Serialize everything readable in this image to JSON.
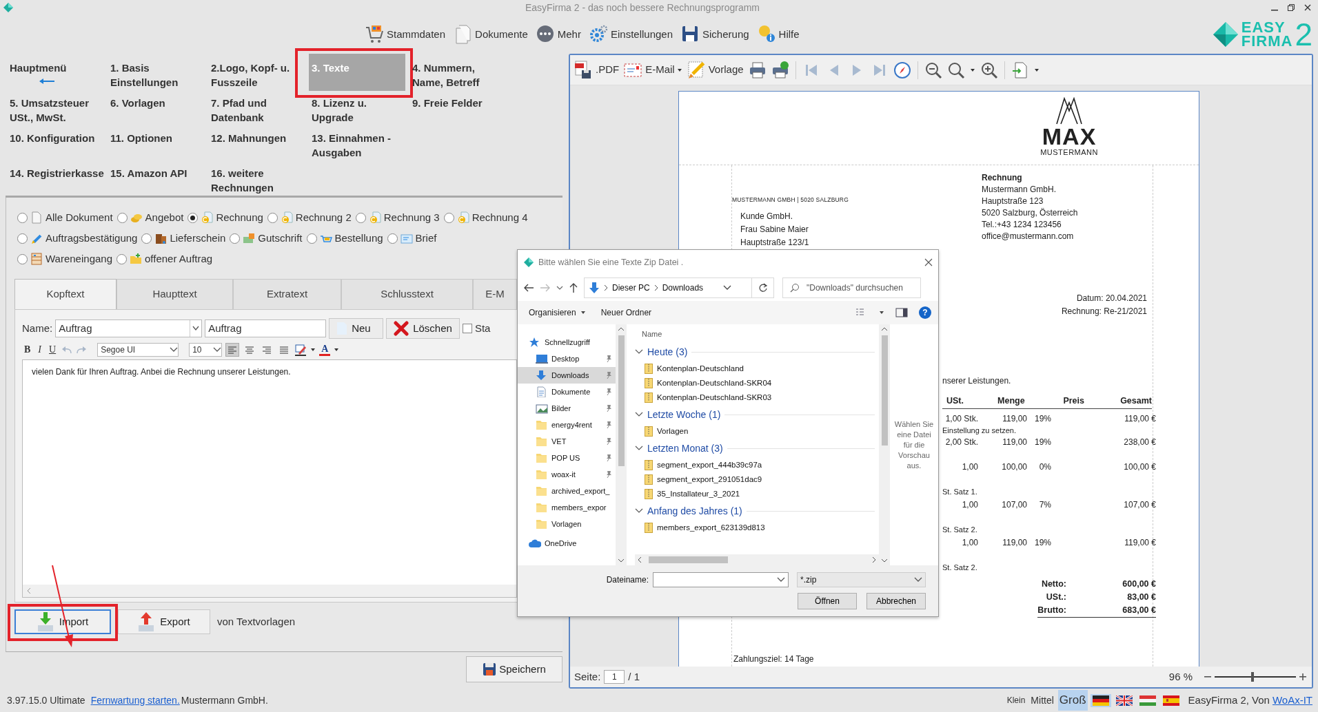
{
  "window": {
    "title": "EasyFirma 2 - das noch bessere Rechnungsprogramm"
  },
  "toolbar": [
    {
      "label": "Stammdaten"
    },
    {
      "label": "Dokumente"
    },
    {
      "label": "Mehr"
    },
    {
      "label": "Einstellungen"
    },
    {
      "label": "Sicherung"
    },
    {
      "label": "Hilfe"
    }
  ],
  "logo": {
    "line1": "EASY",
    "line2": "FIRMA",
    "number": "2"
  },
  "main_menu": [
    [
      {
        "label": "Hauptmenü",
        "kind": "back",
        "selected": false,
        "highlighted": false
      },
      {
        "label": "1. Basis Einstellungen",
        "kind": "page",
        "selected": false,
        "highlighted": false
      },
      {
        "label": "2.Logo, Kopf- u. Fusszeile",
        "kind": "page",
        "selected": false,
        "highlighted": false
      },
      {
        "label": "3. Texte",
        "kind": "page",
        "selected": true,
        "highlighted": true
      },
      {
        "label": "4. Nummern, Name, Betreff",
        "kind": "page",
        "selected": false,
        "highlighted": false
      }
    ],
    [
      {
        "label": "5. Umsatzsteuer USt., MwSt.",
        "kind": "page",
        "selected": false,
        "highlighted": false
      },
      {
        "label": "6. Vorlagen",
        "kind": "page",
        "selected": false,
        "highlighted": false
      },
      {
        "label": "7. Pfad und Datenbank",
        "kind": "page",
        "selected": false,
        "highlighted": false
      },
      {
        "label": "8. Lizenz u. Upgrade",
        "kind": "page",
        "selected": false,
        "highlighted": false
      },
      {
        "label": "9. Freie Felder",
        "kind": "page",
        "selected": false,
        "highlighted": false
      }
    ],
    [
      {
        "label": "10. Konfiguration",
        "kind": "page",
        "selected": false,
        "highlighted": false
      },
      {
        "label": "11. Optionen",
        "kind": "page",
        "selected": false,
        "highlighted": false
      },
      {
        "label": "12. Mahnungen",
        "kind": "page",
        "selected": false,
        "highlighted": false
      },
      {
        "label": "13. Einnahmen - Ausgaben",
        "kind": "page",
        "selected": false,
        "highlighted": false
      }
    ],
    [
      {
        "label": "14. Registrierkasse",
        "kind": "page",
        "selected": false,
        "highlighted": false
      },
      {
        "label": "15. Amazon API",
        "kind": "page",
        "selected": false,
        "highlighted": false
      },
      {
        "label": "16. weitere Rechnungen",
        "kind": "page",
        "selected": false,
        "highlighted": false
      }
    ]
  ],
  "document_types": [
    [
      {
        "label": "Alle Dokument",
        "selected": false
      },
      {
        "label": "Angebot",
        "selected": false
      },
      {
        "label": "Rechnung",
        "selected": true
      },
      {
        "label": "Rechnung 2",
        "selected": false
      },
      {
        "label": "Rechnung 3",
        "selected": false
      },
      {
        "label": "Rechnung 4",
        "selected": false
      }
    ],
    [
      {
        "label": "Auftragsbestätigung",
        "selected": false
      },
      {
        "label": "Lieferschein",
        "selected": false
      },
      {
        "label": "Gutschrift",
        "selected": false
      },
      {
        "label": "Bestellung",
        "selected": false
      },
      {
        "label": "Brief",
        "selected": false
      }
    ],
    [
      {
        "label": "Wareneingang",
        "selected": false
      },
      {
        "label": "offener Auftrag",
        "selected": false
      }
    ]
  ],
  "text_tabs": [
    {
      "label": "Kopftext",
      "selected": true
    },
    {
      "label": "Haupttext",
      "selected": false
    },
    {
      "label": "Extratext",
      "selected": false
    },
    {
      "label": "Schlusstext",
      "selected": false
    },
    {
      "label": "E-M",
      "selected": false
    }
  ],
  "name_row": {
    "label": "Name:",
    "template": "Auftrag",
    "title": "Auftrag",
    "new_button": "Neu",
    "delete_button": "Löschen",
    "checkbox": {
      "label": "Sta",
      "checked": false
    }
  },
  "format_bar": {
    "bold": "B",
    "italic": "I",
    "underline": "U",
    "font": "Segoe UI",
    "size": "10",
    "font_color": "A",
    "alignments": [
      {
        "selected": true
      },
      {
        "selected": false
      },
      {
        "selected": false
      },
      {
        "selected": false
      }
    ]
  },
  "editor": {
    "text": "vielen Dank für Ihren Auftrag. Anbei die Rechnung unserer Leistungen."
  },
  "templates": {
    "import_button": "Import",
    "export_button": "Export",
    "caption": "von Textvorlagen",
    "import_highlighted": true,
    "arrow": true
  },
  "save_button": "Speichern",
  "preview": {
    "toolbar": [
      {
        "label": ".PDF",
        "dropdown": false
      },
      {
        "label": "E-Mail",
        "dropdown": true
      },
      {
        "label": "Vorlage",
        "dropdown": false
      }
    ],
    "document": {
      "logo_name": "MAX",
      "logo_subtitle": "MUSTERMANN",
      "sender_line": "MUSTERMANN GMBH | 5020 SALZBURG",
      "recipient": [
        "Kunde GmbH.",
        "Frau Sabine Maier",
        "Hauptstraße 123/1"
      ],
      "seller": {
        "title": "Rechnung",
        "lines": [
          "Mustermann GmbH.",
          "Hauptstraße 123",
          "5020 Salzburg, Österreich",
          "Tel.:+43 1234 123456",
          "office@mustermann.com"
        ]
      },
      "dates": [
        "Datum: 20.04.2021",
        "Rechnung: Re-21/2021"
      ],
      "intro": "nserer Leistungen.",
      "table": {
        "columns": [
          "USt.",
          "Menge",
          "Preis",
          "Gesamt"
        ],
        "rows": [
          {
            "kind": "item",
            "cells": [
              "1,00 Stk.",
              "119,00",
              "19%",
              "119,00 €"
            ]
          },
          {
            "kind": "detail",
            "text": "Einstellung zu setzen."
          },
          {
            "kind": "item",
            "cells": [
              "2,00 Stk.",
              "119,00",
              "19%",
              "238,00 €"
            ]
          },
          {
            "kind": "item",
            "cells": [
              "1,00",
              "100,00",
              "0%",
              "100,00 €"
            ]
          },
          {
            "kind": "tax_note",
            "text": "St. Satz 1."
          },
          {
            "kind": "item",
            "cells": [
              "1,00",
              "107,00",
              "7%",
              "107,00 €"
            ]
          },
          {
            "kind": "tax_note",
            "text": "St. Satz 2."
          },
          {
            "kind": "item",
            "cells": [
              "1,00",
              "119,00",
              "19%",
              "119,00 €"
            ]
          },
          {
            "kind": "tax_note",
            "text": "St. Satz 2."
          }
        ]
      },
      "totals": [
        {
          "label": "Netto:",
          "value": "600,00 €"
        },
        {
          "label": "USt.:",
          "value": "83,00 €"
        },
        {
          "label": "Brutto:",
          "value": "683,00 €"
        }
      ],
      "footer": "Zahlungsziel: 14 Tage"
    },
    "pager": {
      "label": "Seite:",
      "page": "1",
      "total": "/ 1"
    },
    "zoom": {
      "reading": "96 %",
      "level": 0.47
    }
  },
  "dialog": {
    "title": "Bitte wählen Sie eine Texte Zip Datei .",
    "path": [
      "Dieser PC",
      "Downloads"
    ],
    "search_placeholder": "\"Downloads\" durchsuchen",
    "commands": [
      {
        "label": "Organisieren",
        "dropdown": true
      },
      {
        "label": "Neuer Ordner",
        "dropdown": false
      }
    ],
    "help": "?",
    "nav": [
      {
        "label": "Schnellzugriff",
        "kind": "star",
        "selected": false,
        "children": [
          {
            "label": "Desktop",
            "kind": "desktop",
            "pinned": true,
            "selected": false
          },
          {
            "label": "Downloads",
            "kind": "download",
            "pinned": true,
            "selected": true
          },
          {
            "label": "Dokumente",
            "kind": "document",
            "pinned": true,
            "selected": false
          },
          {
            "label": "Bilder",
            "kind": "image",
            "pinned": true,
            "selected": false
          },
          {
            "label": "energy4rent",
            "kind": "folder",
            "pinned": true,
            "selected": false
          },
          {
            "label": "VET",
            "kind": "folder",
            "pinned": true,
            "selected": false
          },
          {
            "label": "POP US",
            "kind": "folder",
            "pinned": true,
            "selected": false
          },
          {
            "label": "woax-it",
            "kind": "folder",
            "pinned": true,
            "selected": false
          },
          {
            "label": "archived_export_",
            "kind": "folder",
            "pinned": false,
            "selected": false
          },
          {
            "label": "members_expor",
            "kind": "folder",
            "pinned": false,
            "selected": false
          },
          {
            "label": "Vorlagen",
            "kind": "folder",
            "pinned": false,
            "selected": false
          }
        ]
      },
      {
        "label": "OneDrive",
        "kind": "cloud",
        "selected": false
      }
    ],
    "column": "Name",
    "groups": [
      {
        "title": "Heute (3)",
        "expanded": true,
        "files": [
          "Kontenplan-Deutschland",
          "Kontenplan-Deutschland-SKR04",
          "Kontenplan-Deutschland-SKR03"
        ]
      },
      {
        "title": "Letzte Woche (1)",
        "expanded": true,
        "files": [
          "Vorlagen"
        ]
      },
      {
        "title": "Letzten Monat (3)",
        "expanded": true,
        "files": [
          "segment_export_444b39c97a",
          "segment_export_291051dac9",
          "35_Installateur_3_2021"
        ]
      },
      {
        "title": "Anfang des Jahres (1)",
        "expanded": true,
        "files": [
          "members_export_623139d813"
        ]
      }
    ],
    "preview_hint": "Wählen Sie eine Datei für die Vorschau aus.",
    "filename_label": "Dateiname:",
    "filter": "*.zip",
    "buttons": [
      "Öffnen",
      "Abbrechen"
    ]
  },
  "status_bar": {
    "version": "3.97.15.0 Ultimate",
    "remote_link": "Fernwartung starten.",
    "company": "Mustermann GmbH.",
    "sizes": [
      {
        "label": "Klein",
        "selected": false
      },
      {
        "label": "Mittel",
        "selected": false
      },
      {
        "label": "Groß",
        "selected": true
      }
    ],
    "languages": [
      {
        "selected": true
      },
      {
        "selected": false
      },
      {
        "selected": false
      },
      {
        "selected": false
      }
    ],
    "credit": "EasyFirma 2, Von",
    "vendor_link": "WoAx-IT"
  }
}
